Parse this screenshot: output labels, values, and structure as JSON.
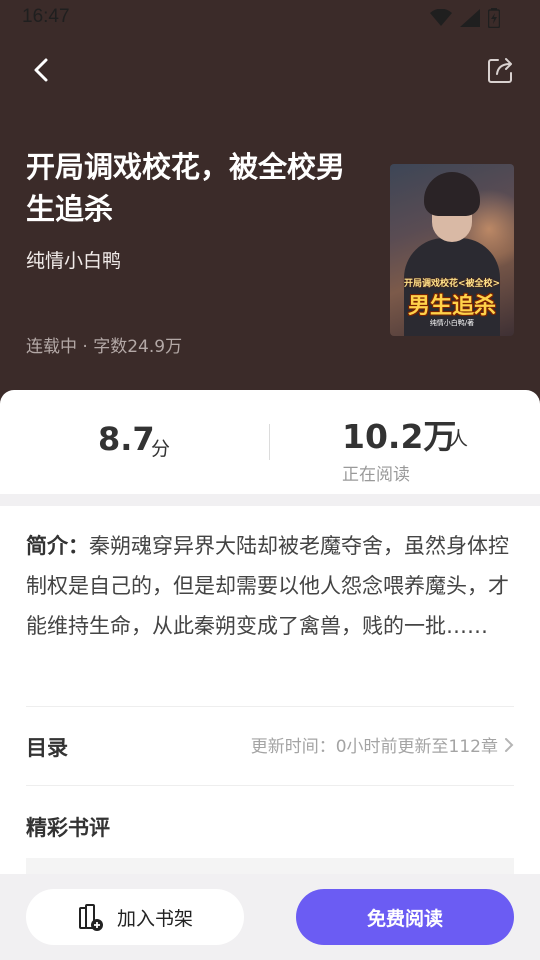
{
  "status_bar": {
    "time": "16:47"
  },
  "book": {
    "title": "开局调戏校花，被全校男生追杀",
    "author": "纯情小白鸭",
    "meta": "连载中 · 字数24.9万",
    "cover": {
      "subtitle": "开局调戏校花<被全校>",
      "title": "男生追杀",
      "author": "纯情小白鸭/著"
    }
  },
  "stats": {
    "score": "8.7",
    "score_unit": "分",
    "readers": "10.2万",
    "readers_unit": "人",
    "readers_label": "正在阅读"
  },
  "intro": {
    "label": "简介：",
    "text": "秦朔魂穿异界大陆却被老魔夺舍，虽然身体控制权是自己的，但是却需要以他人怨念喂养魔头，才能维持生命，从此秦朔变成了禽兽，贱的一批……"
  },
  "toc": {
    "title": "目录",
    "info": "更新时间：0小时前更新至112章"
  },
  "reviews": {
    "title": "精彩书评"
  },
  "actions": {
    "add_shelf": "加入书架",
    "read_free": "免费阅读"
  },
  "colors": {
    "header_bg": "#3b2b29",
    "accent": "#6b5cf3"
  }
}
